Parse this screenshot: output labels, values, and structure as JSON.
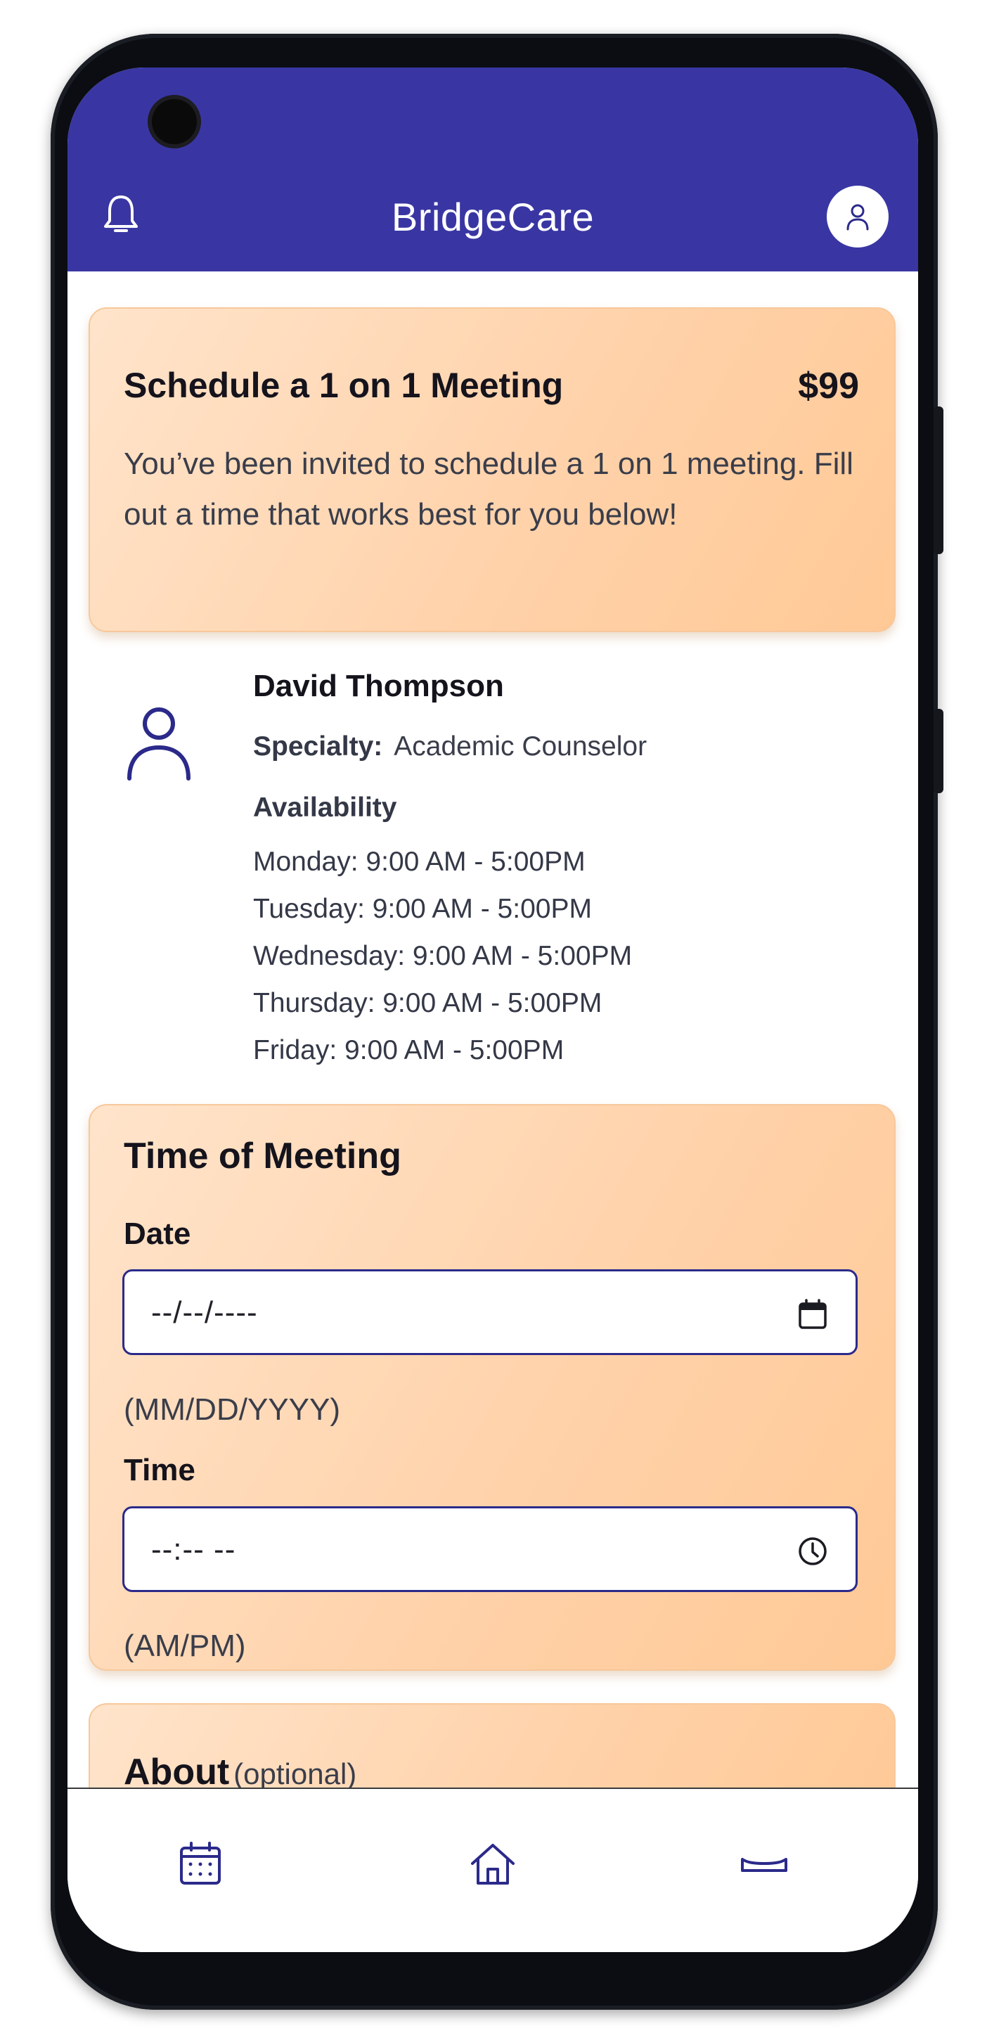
{
  "header": {
    "app_title": "BridgeCare"
  },
  "schedule_card": {
    "title": "Schedule a 1 on 1 Meeting",
    "price": "$99",
    "description": "You’ve been invited to schedule a 1 on 1 meeting. Fill out a time that works best for you below!"
  },
  "counselor": {
    "name": "David Thompson",
    "specialty_label": "Specialty:",
    "specialty_value": "Academic Counselor",
    "availability_label": "Availability",
    "availability": [
      "Monday: 9:00 AM - 5:00PM",
      "Tuesday: 9:00 AM - 5:00PM",
      "Wednesday: 9:00 AM - 5:00PM",
      "Thursday: 9:00 AM - 5:00PM",
      "Friday: 9:00 AM - 5:00PM"
    ]
  },
  "meeting_card": {
    "title": "Time of Meeting",
    "date_label": "Date",
    "date_value": "--/--/----",
    "date_hint": "(MM/DD/YYYY)",
    "time_label": "Time",
    "time_value": "--:-- --",
    "time_hint": "(AM/PM)"
  },
  "about_card": {
    "title": "About",
    "optional": "(optional)"
  },
  "icons": {
    "bell": "bell-icon",
    "avatar": "user-icon",
    "profile": "user-icon",
    "date_picker": "calendar-icon",
    "time_picker": "clock-icon",
    "nav": [
      "calendar-icon",
      "home-icon",
      "bed-icon"
    ]
  },
  "colors": {
    "header_bg": "#3936a3",
    "accent": "#2b2a8a",
    "card_bg": "#ffd7b3"
  }
}
